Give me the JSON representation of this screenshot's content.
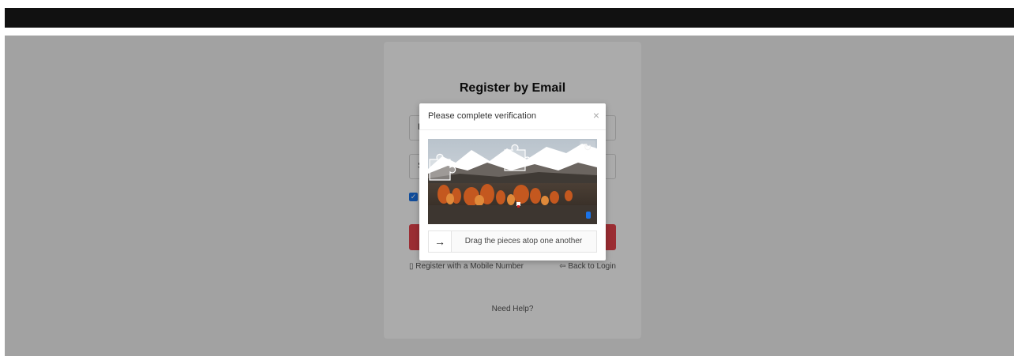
{
  "card": {
    "title": "Register by Email",
    "field1_placeholder": "E",
    "field2_placeholder": "S",
    "mobile_link": "Register with a Mobile Number",
    "back_link": "Back to Login",
    "need_help": "Need Help?"
  },
  "dialog": {
    "title": "Please complete verification",
    "slider_text": "Drag the pieces atop one another"
  },
  "icons": {
    "close": "close-icon",
    "refresh": "refresh-icon",
    "arrow": "arrow-right-icon",
    "phone": "phone-icon",
    "back": "back-icon",
    "check": "check-icon"
  },
  "colors": {
    "submit": "#e8444d",
    "checkbox": "#1a73e8",
    "topbar": "#111111"
  }
}
